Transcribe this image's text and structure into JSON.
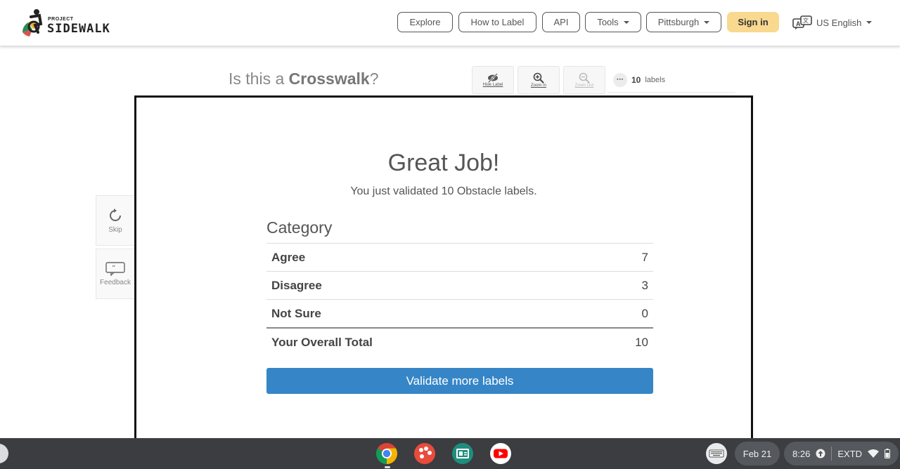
{
  "logo": {
    "project": "PROJECT",
    "name": "SIDEWALK"
  },
  "nav": {
    "explore": "Explore",
    "how_to_label": "How to Label",
    "api": "API",
    "tools": "Tools",
    "city": "Pittsburgh",
    "sign_in": "Sign in",
    "language": "US English"
  },
  "validate": {
    "question_prefix": "Is this a ",
    "label_type": "Crosswalk",
    "question_suffix": "?",
    "hide_label": "Hide Label",
    "zoom_in": "Zoom In",
    "zoom_out": "Zoom Out",
    "label_count": "10",
    "label_count_unit": "labels",
    "skip": "Skip",
    "feedback": "Feedback"
  },
  "modal": {
    "title": "Great Job!",
    "subtitle": "You just validated 10 Obstacle labels.",
    "category_header": "Category",
    "rows": [
      {
        "label": "Agree",
        "value": "7"
      },
      {
        "label": "Disagree",
        "value": "3"
      },
      {
        "label": "Not Sure",
        "value": "0"
      }
    ],
    "total_label": "Your Overall Total",
    "total_value": "10",
    "button": "Validate more labels"
  },
  "taskbar": {
    "date": "Feb 21",
    "time": "8:26",
    "status": "EXTD"
  },
  "colors": {
    "accent": "#3686c7",
    "signin": "#f9d88f",
    "taskbar": "#3b3d40"
  }
}
